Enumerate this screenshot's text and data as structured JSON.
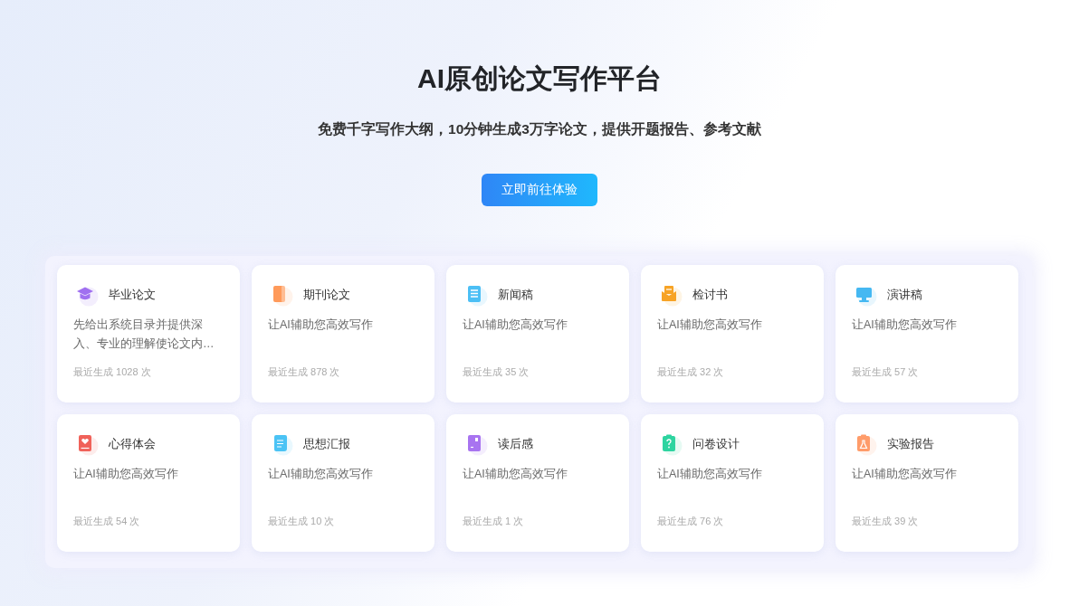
{
  "hero": {
    "title": "AI原创论文写作平台",
    "subtitle": "免费千字写作大纲，10分钟生成3万字论文，提供开题报告、参考文献",
    "cta_button": "立即前往体验"
  },
  "cards": [
    {
      "title": "毕业论文",
      "description": "先给出系统目录并提供深入、专业的理解使论文内…",
      "usage": "最近生成 1028 次",
      "color": "#a070f0"
    },
    {
      "title": "期刊论文",
      "description": "让AI辅助您高效写作",
      "usage": "最近生成 878 次",
      "color": "#ff9a5a"
    },
    {
      "title": "新闻稿",
      "description": "让AI辅助您高效写作",
      "usage": "最近生成 35 次",
      "color": "#4cbff5"
    },
    {
      "title": "检讨书",
      "description": "让AI辅助您高效写作",
      "usage": "最近生成 32 次",
      "color": "#f7a325"
    },
    {
      "title": "演讲稿",
      "description": "让AI辅助您高效写作",
      "usage": "最近生成 57 次",
      "color": "#45b8f2"
    },
    {
      "title": "心得体会",
      "description": "让AI辅助您高效写作",
      "usage": "最近生成 54 次",
      "color": "#f0625a"
    },
    {
      "title": "思想汇报",
      "description": "让AI辅助您高效写作",
      "usage": "最近生成 10 次",
      "color": "#4bc3f5"
    },
    {
      "title": "读后感",
      "description": "让AI辅助您高效写作",
      "usage": "最近生成 1 次",
      "color": "#a874f0"
    },
    {
      "title": "问卷设计",
      "description": "让AI辅助您高效写作",
      "usage": "最近生成 76 次",
      "color": "#2ed4a0"
    },
    {
      "title": "实验报告",
      "description": "让AI辅助您高效写作",
      "usage": "最近生成 39 次",
      "color": "#ff9c6a"
    }
  ]
}
